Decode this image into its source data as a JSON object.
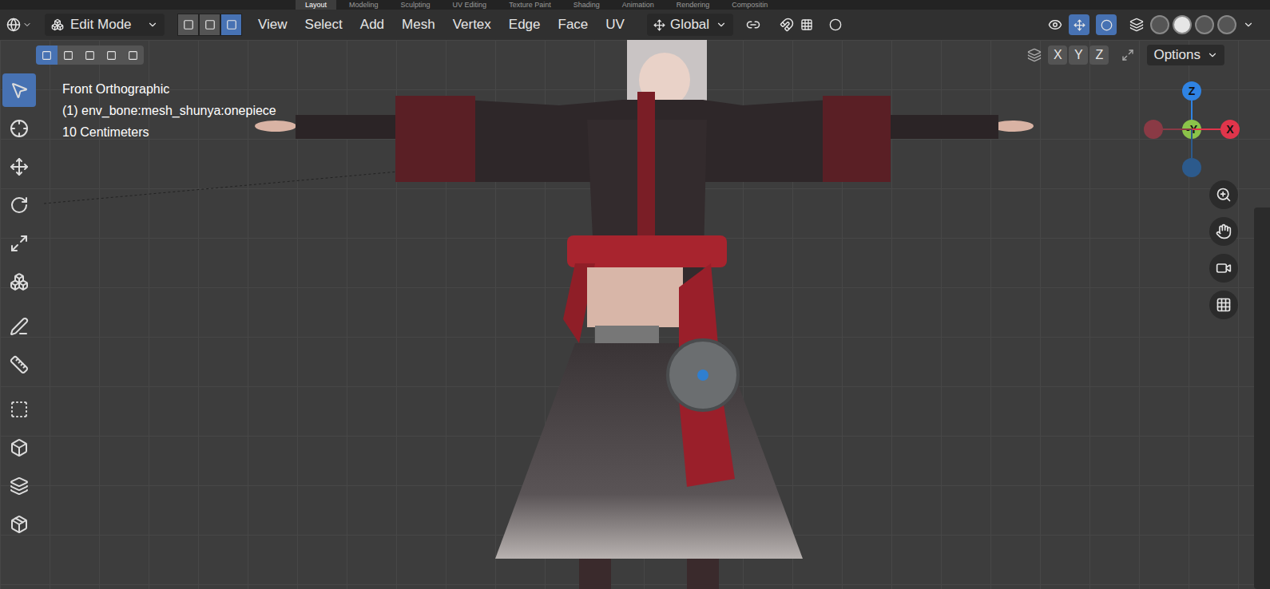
{
  "workspaces": [
    {
      "label": "Layout",
      "selected": true
    },
    {
      "label": "Modeling",
      "selected": false
    },
    {
      "label": "Sculpting",
      "selected": false
    },
    {
      "label": "UV Editing",
      "selected": false
    },
    {
      "label": "Texture Paint",
      "selected": false
    },
    {
      "label": "Shading",
      "selected": false
    },
    {
      "label": "Animation",
      "selected": false
    },
    {
      "label": "Rendering",
      "selected": false
    },
    {
      "label": "Compositin",
      "selected": false
    }
  ],
  "header": {
    "mode": "Edit Mode",
    "select_modes": [
      {
        "name": "vertex",
        "selected": false
      },
      {
        "name": "edge",
        "selected": false
      },
      {
        "name": "face",
        "selected": true
      }
    ],
    "menus": [
      "View",
      "Select",
      "Add",
      "Mesh",
      "Vertex",
      "Edge",
      "Face",
      "UV"
    ],
    "orientation": "Global"
  },
  "subheader": {
    "box_modes": [
      {
        "name": "new",
        "selected": true
      },
      {
        "name": "extend",
        "selected": false
      },
      {
        "name": "subtract",
        "selected": false
      },
      {
        "name": "invert",
        "selected": false
      },
      {
        "name": "intersect",
        "selected": false
      }
    ],
    "mirror_axes": [
      "X",
      "Y",
      "Z"
    ],
    "options": "Options"
  },
  "viewport": {
    "view": "Front Orthographic",
    "object": "(1) env_bone:mesh_shunya:onepiece",
    "scale": "10 Centimeters"
  },
  "tools": [
    {
      "name": "select-box",
      "selected": true
    },
    {
      "name": "cursor",
      "selected": false
    },
    {
      "name": "move",
      "selected": false
    },
    {
      "name": "rotate",
      "selected": false
    },
    {
      "name": "scale",
      "selected": false
    },
    {
      "name": "transform",
      "selected": false
    },
    {
      "name": "annotate",
      "selected": false
    },
    {
      "name": "measure",
      "selected": false
    },
    {
      "name": "add-cube",
      "selected": false
    },
    {
      "name": "extrude",
      "selected": false
    },
    {
      "name": "inset",
      "selected": false
    },
    {
      "name": "bevel",
      "selected": false
    }
  ],
  "gizmo": [
    {
      "label": "Z",
      "color": "#2f83e3"
    },
    {
      "label": "-Y",
      "color": "#8bc34a"
    },
    {
      "label": "X",
      "color": "#e0354b"
    },
    {
      "label": "",
      "color": "#8a3a45"
    },
    {
      "label": "",
      "color": "#2c5a8c"
    }
  ]
}
